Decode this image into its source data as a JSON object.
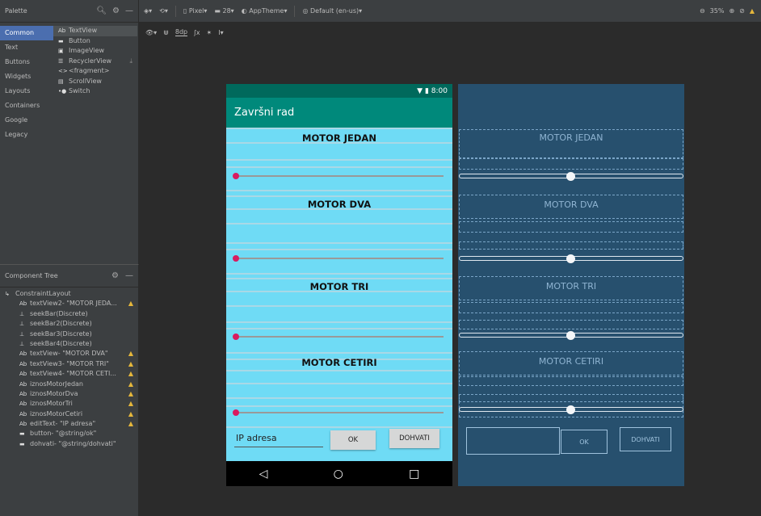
{
  "palette": {
    "title": "Palette",
    "categories": [
      "Common",
      "Text",
      "Buttons",
      "Widgets",
      "Layouts",
      "Containers",
      "Google",
      "Legacy"
    ],
    "items": [
      {
        "icon": "Ab",
        "label": "TextView"
      },
      {
        "icon": "▬",
        "label": "Button"
      },
      {
        "icon": "▣",
        "label": "ImageView"
      },
      {
        "icon": "☰",
        "label": "RecyclerView"
      },
      {
        "icon": "<>",
        "label": "<fragment>"
      },
      {
        "icon": "▤",
        "label": "ScrollView"
      },
      {
        "icon": "•●",
        "label": "Switch"
      }
    ]
  },
  "toolbar": {
    "device": "Pixel",
    "api": "28",
    "theme": "AppTheme",
    "locale": "Default (en-us)",
    "zoom": "35%",
    "margin": "8dp"
  },
  "tree": {
    "title": "Component Tree",
    "root": "ConstraintLayout",
    "items": [
      {
        "icon": "Ab",
        "label": "textView2- \"MOTOR JEDA...",
        "warn": true
      },
      {
        "icon": "⊥",
        "label": "seekBar(Discrete)",
        "warn": false
      },
      {
        "icon": "⊥",
        "label": "seekBar2(Discrete)",
        "warn": false
      },
      {
        "icon": "⊥",
        "label": "seekBar3(Discrete)",
        "warn": false
      },
      {
        "icon": "⊥",
        "label": "seekBar4(Discrete)",
        "warn": false
      },
      {
        "icon": "Ab",
        "label": "textView- \"MOTOR DVA\"",
        "warn": true
      },
      {
        "icon": "Ab",
        "label": "textView3- \"MOTOR TRI\"",
        "warn": true
      },
      {
        "icon": "Ab",
        "label": "textView4- \"MOTOR CETI...",
        "warn": true
      },
      {
        "icon": "Ab",
        "label": "iznosMotorJedan",
        "warn": true
      },
      {
        "icon": "Ab",
        "label": "iznosMotorDva",
        "warn": true
      },
      {
        "icon": "Ab",
        "label": "iznosMotorTri",
        "warn": true
      },
      {
        "icon": "Ab",
        "label": "iznosMotorCetiri",
        "warn": true
      },
      {
        "icon": "Ab",
        "label": "editText- \"IP adresa\"",
        "warn": true
      },
      {
        "icon": "▬",
        "label": "button- \"@string/ok\"",
        "warn": false
      },
      {
        "icon": "▬",
        "label": "dohvati- \"@string/dohvati\"",
        "warn": false
      }
    ]
  },
  "phone": {
    "time": "8:00",
    "app_title": "Završni rad",
    "motor_labels": [
      "MOTOR JEDAN",
      "MOTOR DVA",
      "MOTOR TRI",
      "MOTOR CETIRI"
    ],
    "ip_placeholder": "IP adresa",
    "ok_label": "OK",
    "dohvati_label": "DOHVATI",
    "nav_back": "◁",
    "nav_home": "○",
    "nav_recents": "□"
  },
  "blueprint": {
    "motor_labels": [
      "MOTOR JEDAN",
      "MOTOR DVA",
      "MOTOR TRI",
      "MOTOR CETIRI"
    ],
    "ok_label": "OK",
    "dohvati_label": "DOHVATI"
  }
}
